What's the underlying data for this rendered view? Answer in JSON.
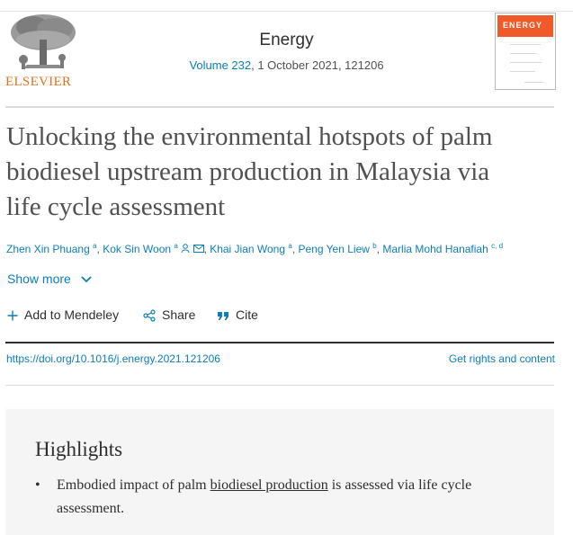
{
  "header": {
    "publisher": "ELSEVIER",
    "journal": "Energy",
    "volume_link": "Volume 232",
    "issue_rest": ", 1 October 2021, 121206",
    "cover_text": "ENERGY"
  },
  "article": {
    "title": "Unlocking the environmental hotspots of palm biodiesel upstream production in Malaysia via life cycle assessment",
    "authors": [
      {
        "name": "Zhen Xin Phuang",
        "aff": "a"
      },
      {
        "name": "Kok Sin Woon",
        "aff": "a"
      },
      {
        "name": "Khai Jian Wong",
        "aff": "a"
      },
      {
        "name": "Peng Yen Liew",
        "aff": "b"
      },
      {
        "name": "Marlia Mohd Hanafiah",
        "aff": "c, d"
      }
    ],
    "show_more": "Show more"
  },
  "actions": {
    "add_mendeley": "Add to Mendeley",
    "share": "Share",
    "cite": "Cite"
  },
  "links": {
    "doi": "https://doi.org/10.1016/j.energy.2021.121206",
    "rights": "Get rights and content"
  },
  "highlights": {
    "heading": "Highlights",
    "item1_pre": "Embodied impact of palm ",
    "item1_link": "biodiesel production",
    "item1_post": " is assessed via life cycle assessment."
  },
  "colors": {
    "link": "#0c7dbb",
    "brand": "#e9711c",
    "highlight_bg": "#f5f5f5"
  },
  "icons": [
    "elsevier-tree-logo",
    "person-icon",
    "envelope-icon",
    "chevron-down-icon",
    "plus-icon",
    "share-icon",
    "quote-icon"
  ]
}
